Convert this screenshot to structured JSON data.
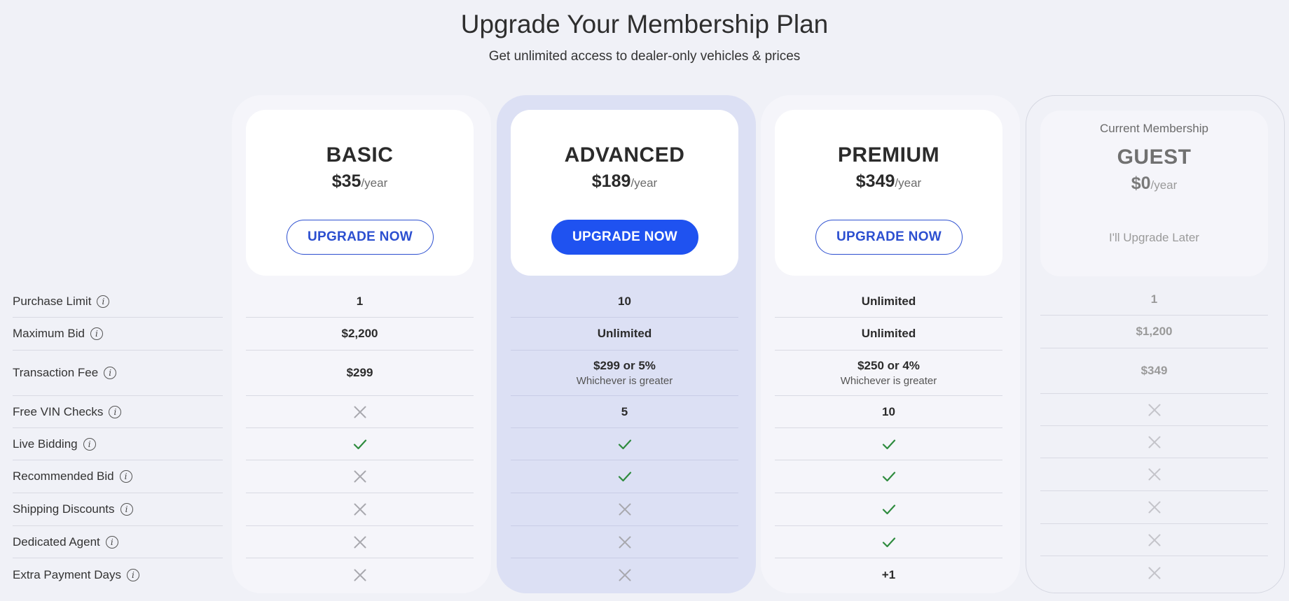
{
  "header": {
    "title": "Upgrade Your Membership Plan",
    "subtitle": "Get unlimited access to dealer-only vehicles & prices"
  },
  "features": [
    {
      "label": "Purchase Limit",
      "icon": "info-icon"
    },
    {
      "label": "Maximum Bid",
      "icon": "info-icon"
    },
    {
      "label": "Transaction Fee",
      "icon": "info-icon"
    },
    {
      "label": "Free VIN Checks",
      "icon": "info-icon"
    },
    {
      "label": "Live Bidding",
      "icon": "info-icon"
    },
    {
      "label": "Recommended Bid",
      "icon": "info-icon"
    },
    {
      "label": "Shipping Discounts",
      "icon": "info-icon"
    },
    {
      "label": "Dedicated Agent",
      "icon": "info-icon"
    },
    {
      "label": "Extra Payment Days",
      "icon": "info-icon"
    }
  ],
  "plans": [
    {
      "name": "BASIC",
      "price": "$35",
      "period": "/year",
      "button": "UPGRADE NOW",
      "button_style": "outline",
      "values": [
        {
          "text": "1"
        },
        {
          "text": "$2,200"
        },
        {
          "text": "$299"
        },
        {
          "mark": "cross"
        },
        {
          "mark": "check"
        },
        {
          "mark": "cross"
        },
        {
          "mark": "cross"
        },
        {
          "mark": "cross"
        },
        {
          "mark": "cross"
        }
      ]
    },
    {
      "name": "ADVANCED",
      "price": "$189",
      "period": "/year",
      "button": "UPGRADE NOW",
      "button_style": "primary",
      "values": [
        {
          "text": "10"
        },
        {
          "text": "Unlimited"
        },
        {
          "text": "$299 or 5%",
          "sub": "Whichever is greater"
        },
        {
          "text": "5"
        },
        {
          "mark": "check"
        },
        {
          "mark": "check"
        },
        {
          "mark": "cross"
        },
        {
          "mark": "cross"
        },
        {
          "mark": "cross"
        }
      ]
    },
    {
      "name": "PREMIUM",
      "price": "$349",
      "period": "/year",
      "button": "UPGRADE NOW",
      "button_style": "outline",
      "values": [
        {
          "text": "Unlimited"
        },
        {
          "text": "Unlimited"
        },
        {
          "text": "$250 or 4%",
          "sub": "Whichever is greater"
        },
        {
          "text": "10"
        },
        {
          "mark": "check"
        },
        {
          "mark": "check"
        },
        {
          "mark": "check"
        },
        {
          "mark": "check"
        },
        {
          "text": "+1"
        }
      ]
    },
    {
      "name": "GUEST",
      "price": "$0",
      "period": "/year",
      "current_label": "Current Membership",
      "link": "I'll Upgrade Later",
      "values": [
        {
          "text": "1"
        },
        {
          "text": "$1,200"
        },
        {
          "text": "$349"
        },
        {
          "mark": "cross"
        },
        {
          "mark": "cross"
        },
        {
          "mark": "cross"
        },
        {
          "mark": "cross"
        },
        {
          "mark": "cross"
        },
        {
          "mark": "cross"
        }
      ]
    }
  ],
  "colors": {
    "accent": "#1f52f0",
    "check": "#2e8b3e",
    "cross": "#a8a8ae",
    "cross_muted": "#c4c4ca",
    "background": "#f0f1f7",
    "featured_column": "#dce0f4"
  }
}
